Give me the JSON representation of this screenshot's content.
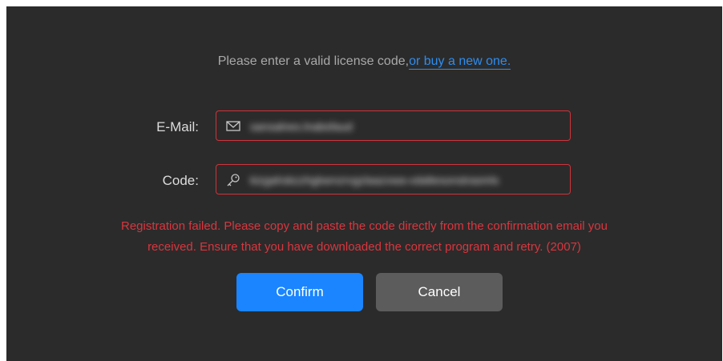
{
  "prompt": {
    "text": "Please enter a valid license code,",
    "link": "or buy a new one."
  },
  "email": {
    "label": "E-Mail:",
    "value": "sansalnes.lnabsfaud"
  },
  "code": {
    "label": "Code:",
    "value": "kizgahskzzhglsenzrvgzlaazvwa-vdaltesonstrasmls"
  },
  "error": {
    "line1": "Registration failed. Please copy and paste the code directly from the confirmation email you",
    "line2": "received. Ensure that you have downloaded the correct program and retry. (2007)"
  },
  "buttons": {
    "confirm": "Confirm",
    "cancel": "Cancel"
  },
  "colors": {
    "background": "#2b2b2b",
    "link": "#2e8df0",
    "error": "#d9363e",
    "confirm": "#1a85ff",
    "cancel": "#5c5c5c"
  }
}
